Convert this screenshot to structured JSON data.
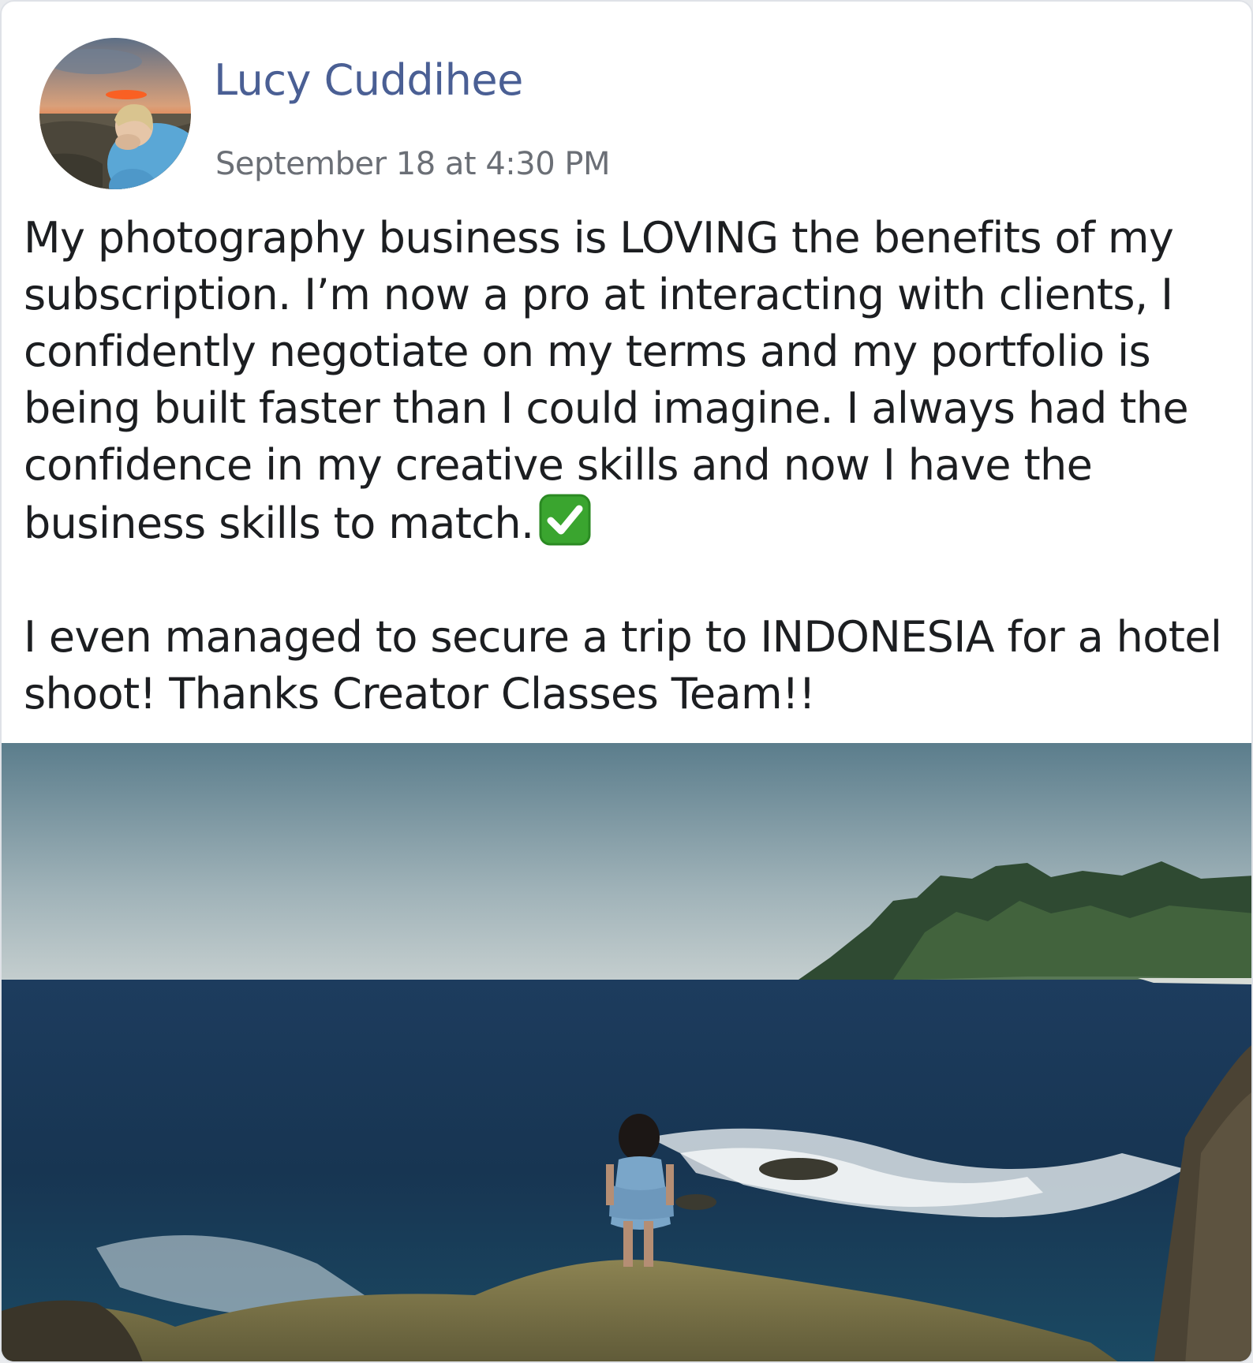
{
  "post": {
    "author_name": "Lucy Cuddihee",
    "timestamp": "September 18 at 4:30 PM",
    "paragraph_1": "My photography business is LOVING the benefits of my subscription. I’m now a pro at interacting with clients, I confidently negotiate on my terms and my portfolio is being built faster than I could imagine. I always had the confidence in my creative skills and now I have the business skills to match.",
    "emoji_icon": "white-check-mark-icon",
    "paragraph_2": "I even managed to secure a trip to INDONESIA for a hotel shoot! Thanks Creator Classes Team!!"
  },
  "colors": {
    "author_name": "#4a5f94",
    "timestamp": "#6b6f76",
    "body_text": "#1c1e21",
    "check_green": "#3aa52f"
  }
}
